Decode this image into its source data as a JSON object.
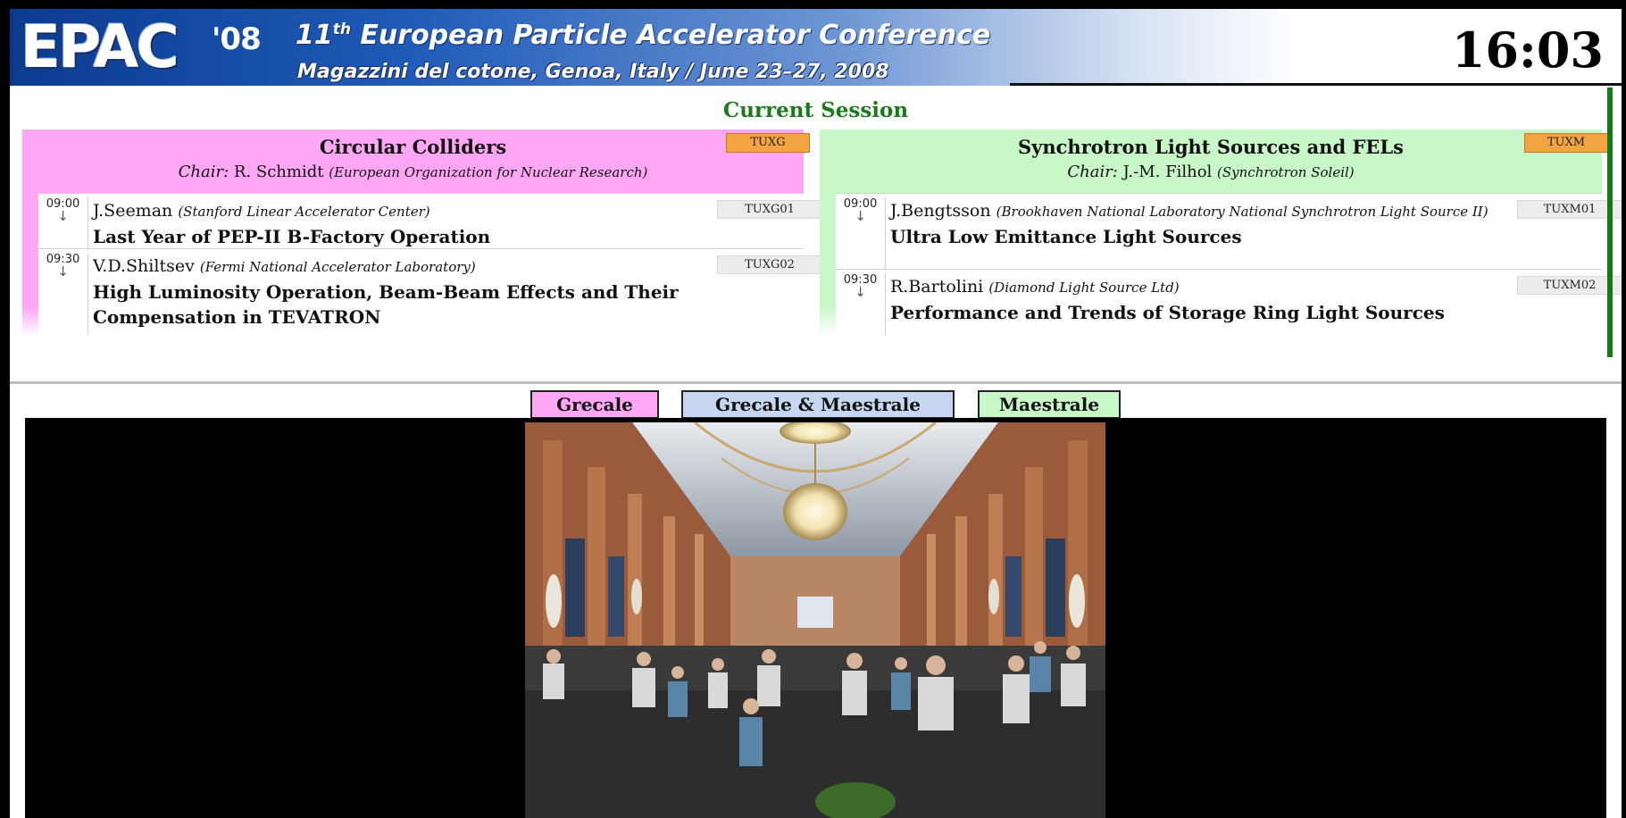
{
  "header": {
    "logo": "EPAC",
    "logo_year": "'08",
    "title_ordinal": "11",
    "title_sup": "th",
    "title_rest": " European Particle Accelerator Conference",
    "venue": "Magazzini del cotone, Genoa, Italy / June 23–27, 2008",
    "clock": "16:03"
  },
  "session_heading": "Current Session",
  "rooms": [
    {
      "title": "Circular Colliders",
      "chair_label": "Chair:",
      "chair_name": "R. Schmidt",
      "chair_institution": "(European Organization for Nuclear Research)",
      "code": "TUXG",
      "color": "#ffa6f5",
      "talks": [
        {
          "time": "09:00",
          "speaker": "J.Seeman",
          "institution": "(Stanford Linear Accelerator Center)",
          "title": "Last Year of PEP-II B-Factory Operation",
          "code": "TUXG01"
        },
        {
          "time": "09:30",
          "speaker": "V.D.Shiltsev",
          "institution": "(Fermi National Accelerator Laboratory)",
          "title": "High Luminosity Operation, Beam-Beam Effects and Their Compensation in TEVATRON",
          "code": "TUXG02"
        }
      ]
    },
    {
      "title": "Synchrotron Light Sources and FELs",
      "chair_label": "Chair:",
      "chair_name": "J.-M. Filhol",
      "chair_institution": "(Synchrotron Soleil)",
      "code": "TUXM",
      "color": "#c8f7c8",
      "talks": [
        {
          "time": "09:00",
          "speaker": "J.Bengtsson",
          "institution": "(Brookhaven National Laboratory National Synchrotron Light Source II)",
          "title": "Ultra Low Emittance Light Sources",
          "code": "TUXM01"
        },
        {
          "time": "09:30",
          "speaker": "R.Bartolini",
          "institution": "(Diamond Light Source Ltd)",
          "title": "Performance and Trends of Storage Ring Light Sources",
          "code": "TUXM02"
        }
      ]
    }
  ],
  "arrow_glyph": "↓",
  "tabs": {
    "grecale": "Grecale",
    "both": "Grecale & Maestrale",
    "maestrale": "Maestrale"
  },
  "colors": {
    "grecale": "#ffa6f5",
    "both": "#c7d7f2",
    "maestrale": "#c8f7c8",
    "session_code": "#f4a341",
    "heading_green": "#1c7a1c"
  }
}
